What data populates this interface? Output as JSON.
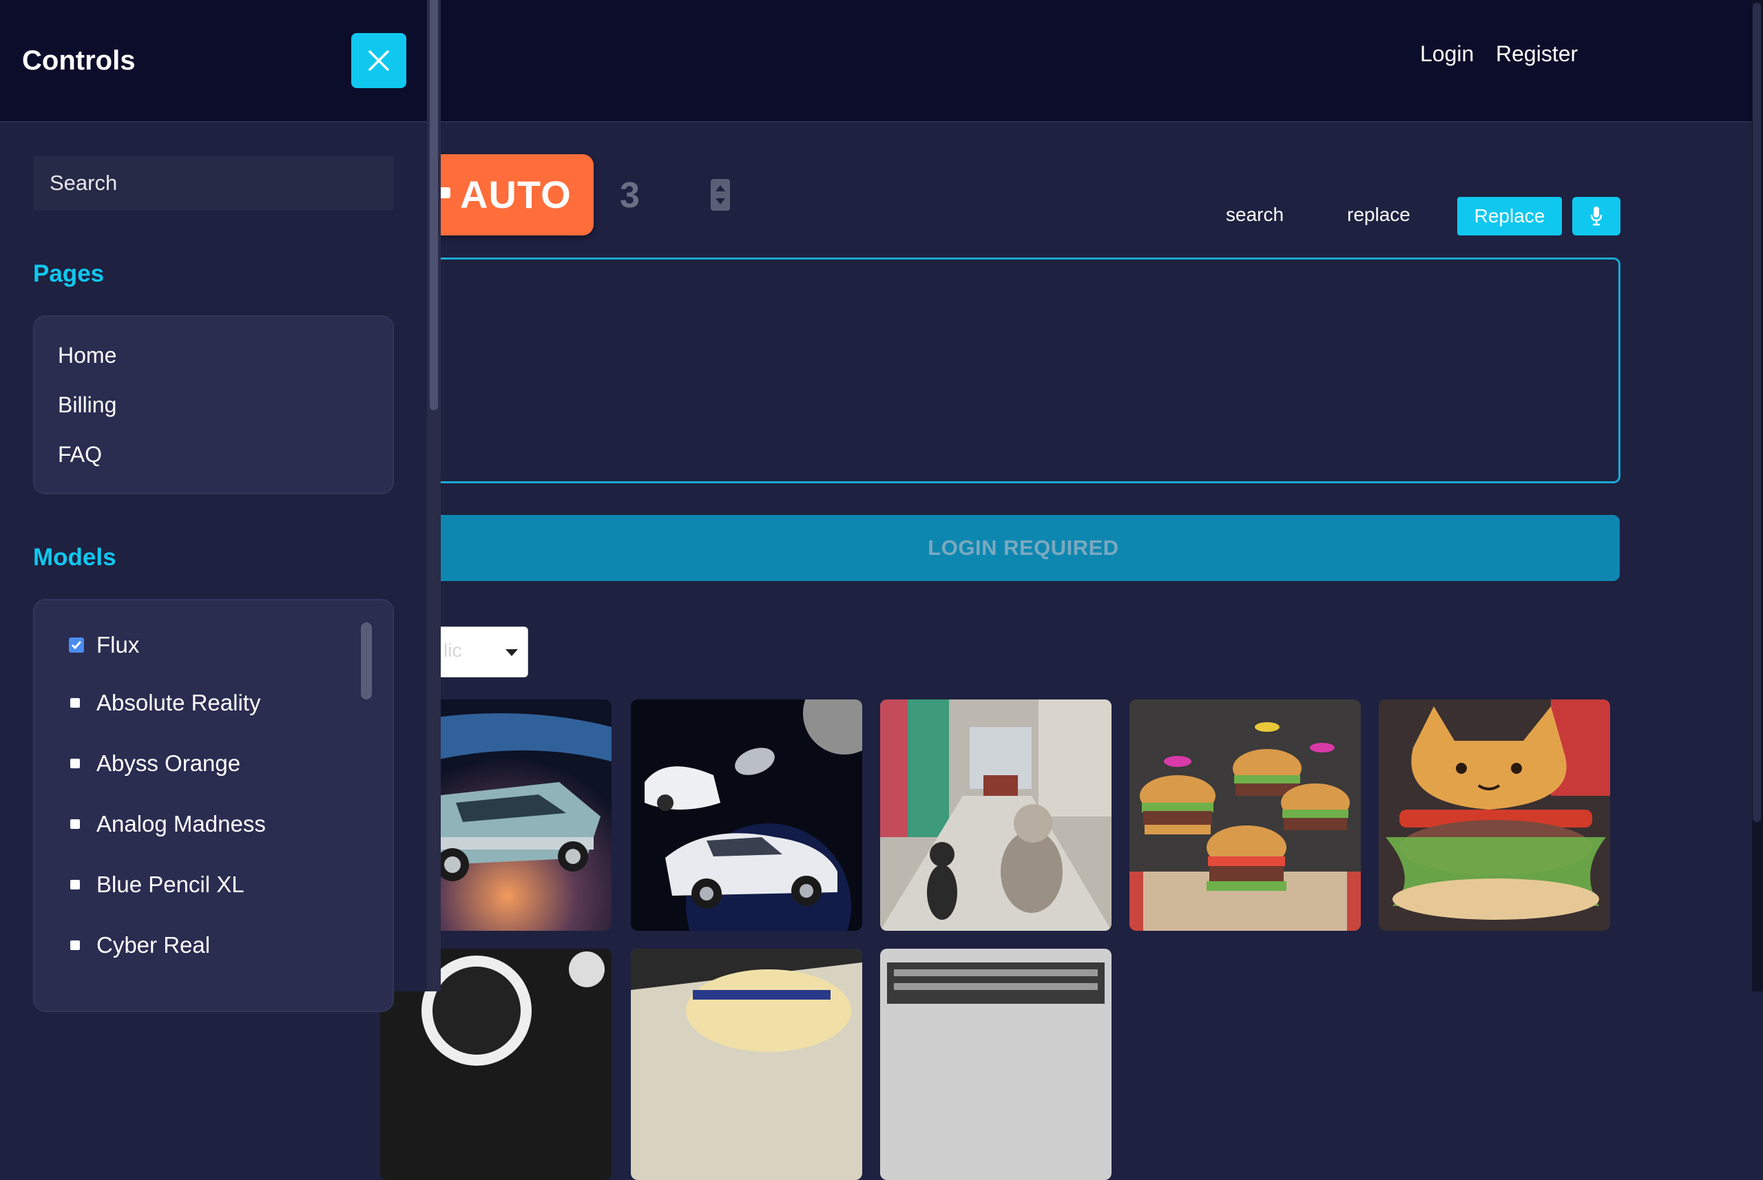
{
  "nav": {
    "login": "Login",
    "register": "Register"
  },
  "toolbar": {
    "auto_label": "AUTO",
    "count": "3",
    "search_link": "search",
    "replace_link": "replace",
    "replace_button": "Replace"
  },
  "main": {
    "login_required": "LOGIN REQUIRED",
    "select_value": "lic"
  },
  "sidebar": {
    "title": "Controls",
    "search_placeholder": "Search",
    "pages_heading": "Pages",
    "pages": [
      "Home",
      "Billing",
      "FAQ"
    ],
    "models_heading": "Models",
    "models": [
      {
        "label": "Flux",
        "checked": true
      },
      {
        "label": "Absolute Reality",
        "checked": false
      },
      {
        "label": "Abyss Orange",
        "checked": false
      },
      {
        "label": "Analog Madness",
        "checked": false
      },
      {
        "label": "Blue Pencil XL",
        "checked": false
      },
      {
        "label": "Cyber Real",
        "checked": false
      }
    ]
  },
  "gallery": {
    "images": [
      "vintage-car-in-space",
      "white-cars-in-space",
      "cats-on-city-street",
      "burgers-with-hats",
      "cat-face-burger",
      "dashboard-gauges",
      "straw-hat",
      "engine-grille"
    ]
  },
  "colors": {
    "accent": "#10c8ef",
    "auto_button": "#ff6d3a",
    "login_button": "#0e87b0",
    "background": "#1e2140",
    "nav_background": "#0b0d2a",
    "section_heading": "#10c8ef"
  }
}
